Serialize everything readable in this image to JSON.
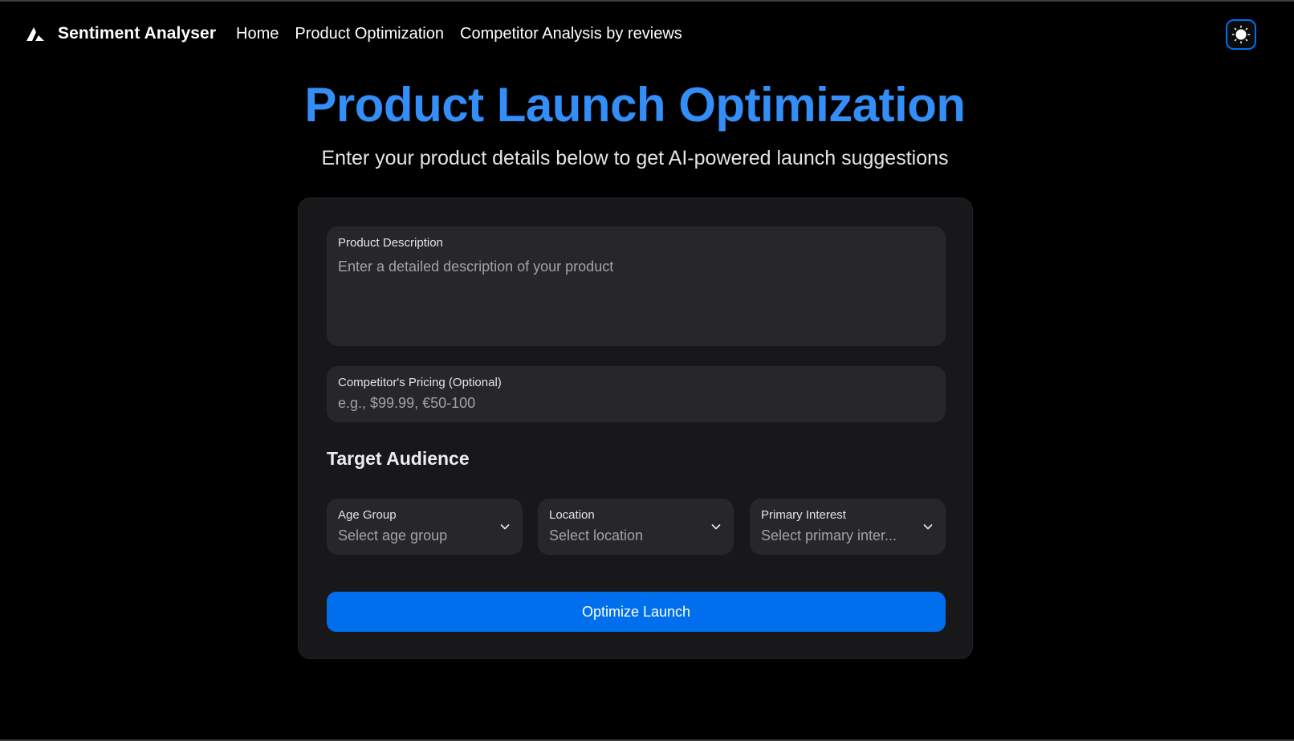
{
  "navbar": {
    "brand_name": "Sentiment Analyser",
    "links": [
      {
        "label": "Home"
      },
      {
        "label": "Product Optimization"
      },
      {
        "label": "Competitor Analysis by reviews"
      }
    ],
    "theme_toggle_icon": "sun-icon"
  },
  "header": {
    "title": "Product Launch Optimization",
    "subtitle": "Enter your product details below to get AI-powered launch suggestions"
  },
  "form": {
    "description": {
      "label": "Product Description",
      "placeholder": "Enter a detailed description of your product",
      "value": ""
    },
    "pricing": {
      "label": "Competitor's Pricing (Optional)",
      "placeholder": "e.g., $99.99, €50-100",
      "value": ""
    },
    "target_audience": {
      "title": "Target Audience",
      "age_group": {
        "label": "Age Group",
        "placeholder": "Select age group"
      },
      "location": {
        "label": "Location",
        "placeholder": "Select location"
      },
      "primary_interest": {
        "label": "Primary Interest",
        "placeholder": "Select primary inter..."
      }
    },
    "submit_label": "Optimize Launch"
  },
  "colors": {
    "accent": "#006FEE",
    "title": "#338EF7",
    "background": "#000000",
    "card": "#18181b",
    "input": "#27272a"
  }
}
